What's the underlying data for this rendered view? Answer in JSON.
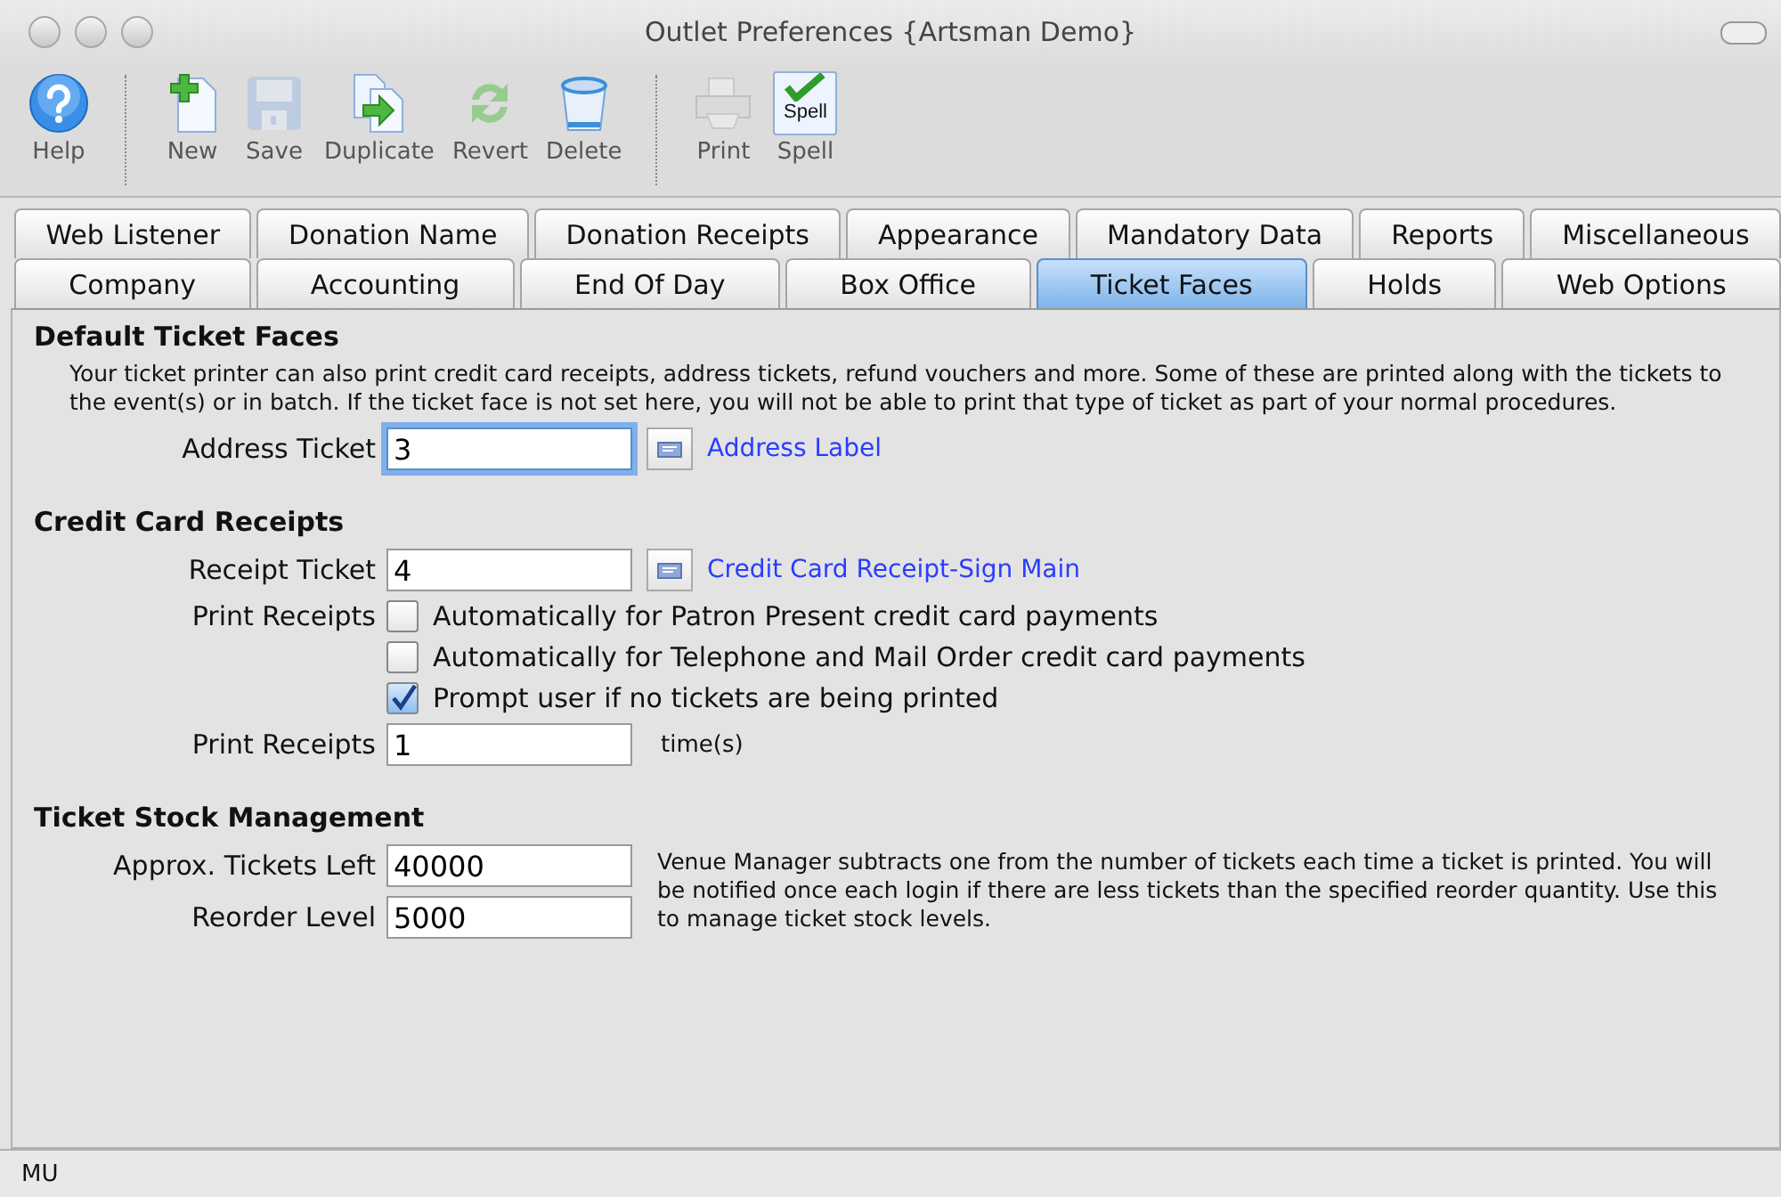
{
  "window": {
    "title": "Outlet Preferences {Artsman Demo}"
  },
  "toolbar": [
    {
      "label": "Help",
      "kind": "help",
      "disabled": false,
      "group_start": false
    },
    {
      "label": "New",
      "kind": "new",
      "disabled": false,
      "group_start": true
    },
    {
      "label": "Save",
      "kind": "save",
      "disabled": true,
      "group_start": false
    },
    {
      "label": "Duplicate",
      "kind": "duplicate",
      "disabled": false,
      "group_start": false
    },
    {
      "label": "Revert",
      "kind": "revert",
      "disabled": true,
      "group_start": false
    },
    {
      "label": "Delete",
      "kind": "delete",
      "disabled": false,
      "group_start": false
    },
    {
      "label": "Print",
      "kind": "print",
      "disabled": true,
      "group_start": true
    },
    {
      "label": "Spell",
      "kind": "spell",
      "disabled": false,
      "group_start": false,
      "icon_text": "Spell"
    }
  ],
  "tab_rows": [
    [
      {
        "label": "Web Listener",
        "selected": false
      },
      {
        "label": "Donation Name",
        "selected": false
      },
      {
        "label": "Donation Receipts",
        "selected": false
      },
      {
        "label": "Appearance",
        "selected": false
      },
      {
        "label": "Mandatory Data",
        "selected": false
      },
      {
        "label": "Reports",
        "selected": false
      },
      {
        "label": "Miscellaneous",
        "selected": false
      }
    ],
    [
      {
        "label": "Company",
        "selected": false
      },
      {
        "label": "Accounting",
        "selected": false
      },
      {
        "label": "End Of Day",
        "selected": false
      },
      {
        "label": "Box Office",
        "selected": false
      },
      {
        "label": "Ticket Faces",
        "selected": true
      },
      {
        "label": "Holds",
        "selected": false
      },
      {
        "label": "Web Options",
        "selected": false
      }
    ]
  ],
  "sections": [
    {
      "heading": "Default Ticket Faces",
      "description": "Your ticket printer can also print credit card receipts, address tickets, refund vouchers and more.  Some of these are printed along with the tickets to the event(s) or in batch.  If the ticket face is not set here, you will not be able to print that type of ticket as part of your normal procedures.",
      "rows": [
        {
          "kind": "face",
          "label": "Address Ticket",
          "value": "3",
          "focused": true,
          "link": "Address Label"
        }
      ]
    },
    {
      "heading": "Credit Card Receipts",
      "rows": [
        {
          "kind": "face",
          "label": "Receipt Ticket",
          "value": "4",
          "focused": false,
          "link": "Credit Card Receipt-Sign Main"
        },
        {
          "kind": "checkbox",
          "label": "Print Receipts",
          "text": "Automatically for Patron Present credit card payments",
          "checked": false
        },
        {
          "kind": "checkbox",
          "text": "Automatically for Telephone and Mail Order credit card payments",
          "checked": false
        },
        {
          "kind": "checkbox",
          "text": "Prompt user if no tickets are being printed",
          "checked": true
        },
        {
          "kind": "count",
          "label": "Print Receipts",
          "value": "1",
          "focused": false,
          "suffix": "time(s)"
        }
      ]
    },
    {
      "heading": "Ticket Stock Management",
      "note": "Venue Manager subtracts one from the number of tickets each time a ticket is printed.  You will be notified once each login if there are less tickets than the specified reorder quantity.  Use this to manage ticket stock levels.",
      "rows": [
        {
          "kind": "count",
          "label": "Approx. Tickets Left",
          "value": "40000",
          "focused": false
        },
        {
          "kind": "count",
          "label": "Reorder Level",
          "value": "5000",
          "focused": false
        }
      ]
    }
  ],
  "status_bar": {
    "text": "MU"
  }
}
